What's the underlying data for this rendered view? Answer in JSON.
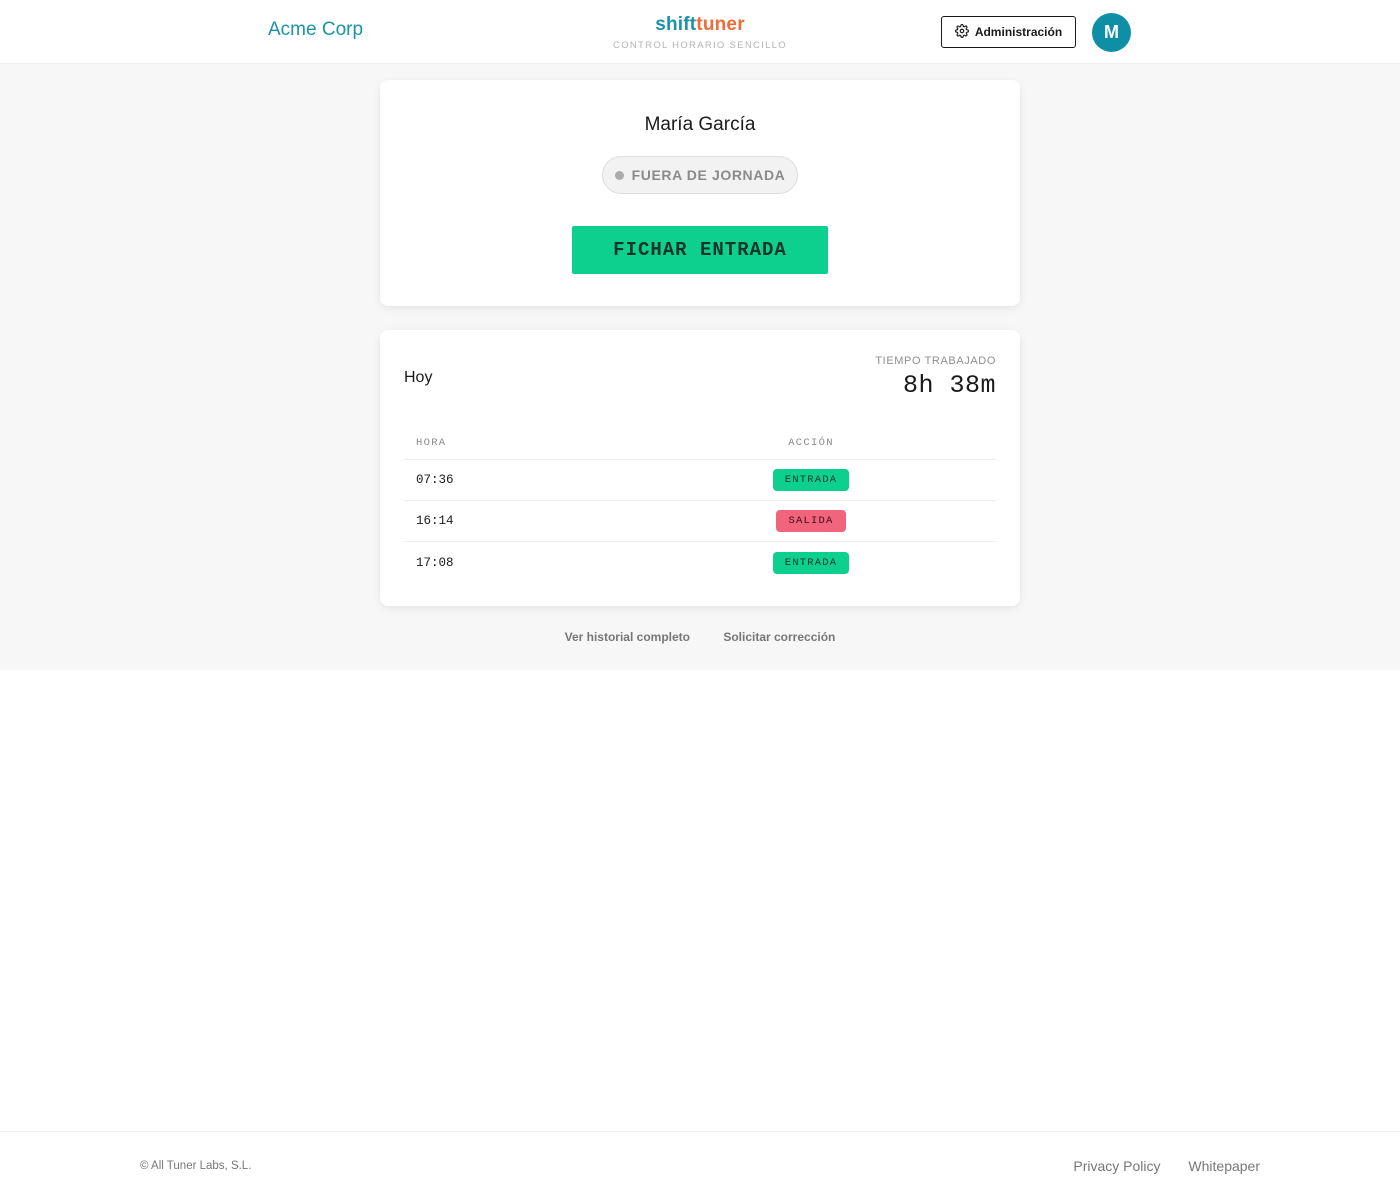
{
  "header": {
    "company": "Acme Corp",
    "brand_shift": "shift",
    "brand_tuner": "tuner",
    "tagline": "CONTROL HORARIO SENCILLO",
    "admin_label": "Administración",
    "avatar_initial": "M"
  },
  "clock": {
    "employee_name": "María García",
    "status": "FUERA DE JORNADA",
    "button_label": "FICHAR ENTRADA"
  },
  "today": {
    "title": "Hoy",
    "worked_label": "TIEMPO TRABAJADO",
    "worked_value": "8h 38m",
    "columns": [
      "HORA",
      "ACCIÓN"
    ],
    "entries": [
      {
        "time": "07:36",
        "action": "ENTRADA",
        "kind": "in"
      },
      {
        "time": "16:14",
        "action": "SALIDA",
        "kind": "out"
      },
      {
        "time": "17:08",
        "action": "ENTRADA",
        "kind": "in"
      }
    ]
  },
  "links": {
    "history": "Ver historial completo",
    "correction": "Solicitar corrección"
  },
  "footer": {
    "copyright": "© All Tuner Labs, S.L.",
    "privacy": "Privacy Policy",
    "whitepaper": "Whitepaper"
  },
  "colors": {
    "accent": "#1a93a8",
    "brand_orange": "#f06b37",
    "entrada": "#0dd08f",
    "salida": "#f2647c"
  }
}
